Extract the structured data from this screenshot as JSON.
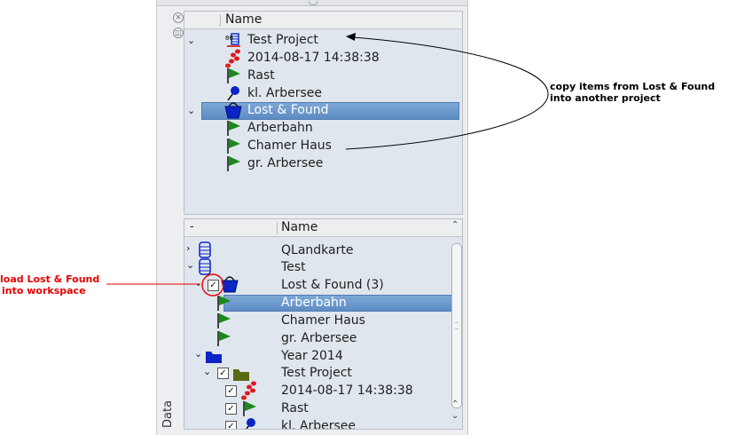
{
  "dock": {
    "vertical_tab": "Data"
  },
  "top_tree": {
    "header": {
      "col_name": "Name"
    },
    "rows": [
      {
        "label": "Test Project",
        "icon": "database-project-icon",
        "expanded": true
      },
      {
        "label": "2014-08-17 14:38:38",
        "icon": "track-icon"
      },
      {
        "label": "Rast",
        "icon": "flag-icon"
      },
      {
        "label": "kl. Arbersee",
        "icon": "pin-icon"
      },
      {
        "label": "Lost & Found",
        "icon": "basket-icon",
        "expanded": true,
        "selected": true
      },
      {
        "label": "Arberbahn",
        "icon": "flag-icon"
      },
      {
        "label": "Chamer Haus",
        "icon": "flag-icon"
      },
      {
        "label": "gr. Arbersee",
        "icon": "flag-icon"
      }
    ]
  },
  "bottom_tree": {
    "header": {
      "col_dash": "-",
      "col_name": "Name"
    },
    "rows": [
      {
        "label": "QLandkarte",
        "icon": "database-icon",
        "expanded": false
      },
      {
        "label": "Test",
        "icon": "database-icon",
        "expanded": true
      },
      {
        "label": "Lost & Found (3)",
        "icon": "basket-icon",
        "checked": true,
        "expanded": true
      },
      {
        "label": "Arberbahn",
        "icon": "flag-icon",
        "selected": true
      },
      {
        "label": "Chamer Haus",
        "icon": "flag-icon"
      },
      {
        "label": "gr. Arbersee",
        "icon": "flag-icon"
      },
      {
        "label": "Year 2014",
        "icon": "folder-blue-icon",
        "expanded": true
      },
      {
        "label": "Test Project",
        "icon": "folder-olive-icon",
        "checked": true,
        "expanded": true
      },
      {
        "label": "2014-08-17 14:38:38",
        "icon": "track-icon",
        "checked": true
      },
      {
        "label": "Rast",
        "icon": "flag-icon",
        "checked": true
      },
      {
        "label": "kl. Arbersee",
        "icon": "pin-icon",
        "checked": true
      }
    ]
  },
  "annotations": {
    "copy_note_line1": "copy items from Lost & Found",
    "copy_note_line2": "into another project",
    "load_note_line1": "load Lost & Found",
    "load_note_line2": "into workspace"
  },
  "colors": {
    "selection": "#5d8bc4",
    "annotation_red": "#e60000",
    "flag_green": "#1a8a1a",
    "blue_icon": "#0a24c8"
  }
}
